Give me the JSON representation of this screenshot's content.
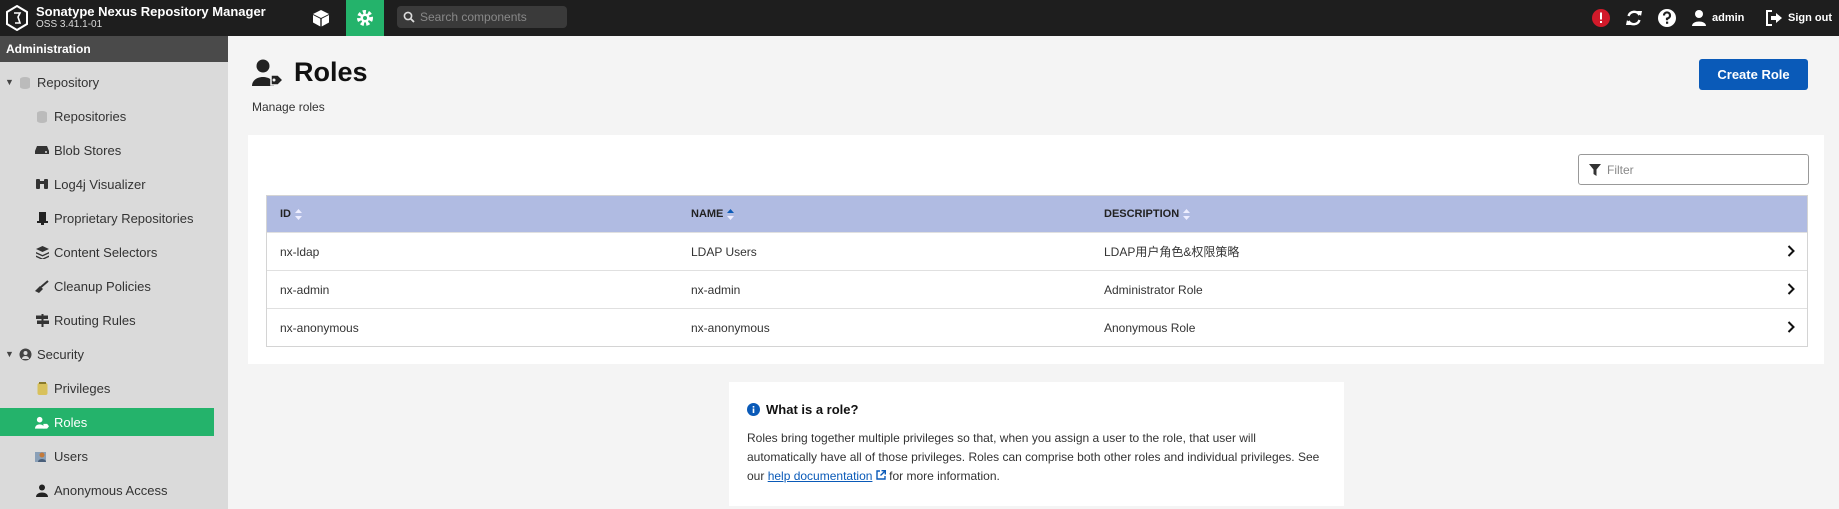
{
  "app": {
    "name": "Sonatype Nexus Repository Manager",
    "version": "OSS 3.41.1-01"
  },
  "topbar": {
    "search_placeholder": "Search components",
    "user_label": "admin",
    "signout_label": "Sign out"
  },
  "sidebar": {
    "header": "Administration",
    "repository_group": "Repository",
    "repository_items": [
      "Repositories",
      "Blob Stores",
      "Log4j Visualizer",
      "Proprietary Repositories",
      "Content Selectors",
      "Cleanup Policies",
      "Routing Rules"
    ],
    "security_group": "Security",
    "security_items": [
      "Privileges",
      "Roles",
      "Users",
      "Anonymous Access"
    ],
    "active_item": "Roles"
  },
  "page": {
    "title": "Roles",
    "subtitle": "Manage roles",
    "create_button": "Create Role"
  },
  "filter": {
    "placeholder": "Filter"
  },
  "table": {
    "headers": {
      "id": "ID",
      "name": "NAME",
      "description": "DESCRIPTION"
    },
    "sorted_column": "NAME",
    "rows": [
      {
        "id": "nx-ldap",
        "name": "LDAP Users",
        "description": "LDAP用户角色&权限策略"
      },
      {
        "id": "nx-admin",
        "name": "nx-admin",
        "description": "Administrator Role"
      },
      {
        "id": "nx-anonymous",
        "name": "nx-anonymous",
        "description": "Anonymous Role"
      }
    ]
  },
  "info": {
    "title": "What is a role?",
    "text_1": "Roles bring together multiple privileges so that, when you assign a user to the role, that user will automatically have all of those privileges. Roles can comprise both other roles and individual privileges. See our",
    "link": "help documentation",
    "text_2": "for more information."
  },
  "colors": {
    "accent_green": "#24b36b",
    "primary_blue": "#0a5ab8",
    "table_header": "#b0bbe2",
    "alert_red": "#d11a2a"
  }
}
